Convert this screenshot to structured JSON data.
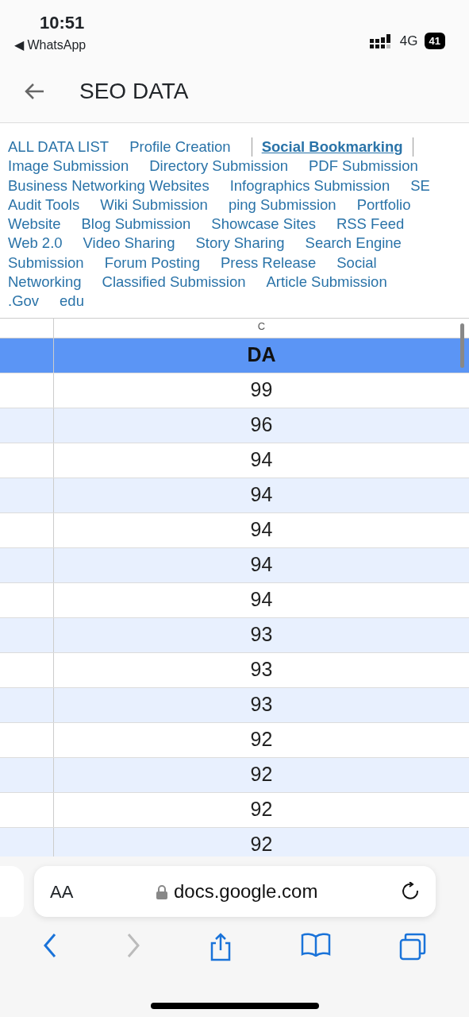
{
  "status_bar": {
    "time": "10:51",
    "back_app": "◀ WhatsApp",
    "network": "4G",
    "battery": "41"
  },
  "app_bar": {
    "title": "SEO DATA"
  },
  "sheet_tabs": [
    [
      {
        "label": "ALL DATA LIST",
        "selected": false
      },
      {
        "label": "Profile Creation",
        "selected": false
      },
      {
        "label": "Social Bookmarking",
        "selected": true
      }
    ],
    [
      {
        "label": "Image Submission",
        "selected": false
      },
      {
        "label": "Directory Submission",
        "selected": false
      },
      {
        "label": "PDF Submission",
        "selected": false
      }
    ],
    [
      {
        "label": "Business Networking Websites",
        "selected": false
      },
      {
        "label": "Infographics Submission",
        "selected": false
      },
      {
        "label": "SE",
        "selected": false
      }
    ],
    [
      {
        "label": "Audit Tools",
        "selected": false
      },
      {
        "label": "Wiki Submission",
        "selected": false
      },
      {
        "label": "ping Submission",
        "selected": false
      },
      {
        "label": "Portfolio",
        "selected": false
      }
    ],
    [
      {
        "label": "Website",
        "selected": false
      },
      {
        "label": "Blog Submission",
        "selected": false
      },
      {
        "label": "Showcase Sites",
        "selected": false
      },
      {
        "label": "RSS Feed",
        "selected": false
      }
    ],
    [
      {
        "label": "Web 2.0",
        "selected": false
      },
      {
        "label": "Video Sharing",
        "selected": false
      },
      {
        "label": "Story Sharing",
        "selected": false
      },
      {
        "label": "Search Engine",
        "selected": false
      }
    ],
    [
      {
        "label": "Submission",
        "selected": false
      },
      {
        "label": "Forum Posting",
        "selected": false
      },
      {
        "label": "Press Release",
        "selected": false
      },
      {
        "label": "Social",
        "selected": false
      }
    ],
    [
      {
        "label": "Networking",
        "selected": false
      },
      {
        "label": "Classified Submission",
        "selected": false
      },
      {
        "label": "Article Submission",
        "selected": false
      }
    ],
    [
      {
        "label": ".Gov",
        "selected": false
      },
      {
        "label": "edu",
        "selected": false
      }
    ]
  ],
  "table": {
    "column_letter": "C",
    "header": "DA",
    "rows": [
      "99",
      "96",
      "94",
      "94",
      "94",
      "94",
      "94",
      "93",
      "93",
      "93",
      "92",
      "92",
      "92",
      "92"
    ]
  },
  "browser": {
    "text_size": "AA",
    "url": "docs.google.com"
  }
}
